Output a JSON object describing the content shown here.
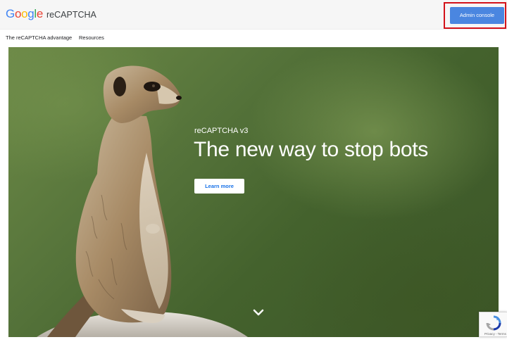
{
  "header": {
    "logo_letters": [
      {
        "char": "G",
        "color": "#4285F4"
      },
      {
        "char": "o",
        "color": "#EA4335"
      },
      {
        "char": "o",
        "color": "#FBBC05"
      },
      {
        "char": "g",
        "color": "#4285F4"
      },
      {
        "char": "l",
        "color": "#34A853"
      },
      {
        "char": "e",
        "color": "#EA4335"
      }
    ],
    "product": "reCAPTCHA",
    "admin_button": "Admin console",
    "highlight_color": "#d3121a",
    "admin_button_color": "#4a86e0"
  },
  "subnav": {
    "items": [
      "The reCAPTCHA advantage",
      "Resources"
    ]
  },
  "hero": {
    "subtitle": "reCAPTCHA v3",
    "title": "The new way to stop bots",
    "cta": "Learn more",
    "scroll_icon": "chevron-down-icon",
    "image": "meerkat-photo"
  },
  "badge": {
    "icon": "recaptcha-logo-icon",
    "privacy_text": "Privacy - Terms"
  }
}
